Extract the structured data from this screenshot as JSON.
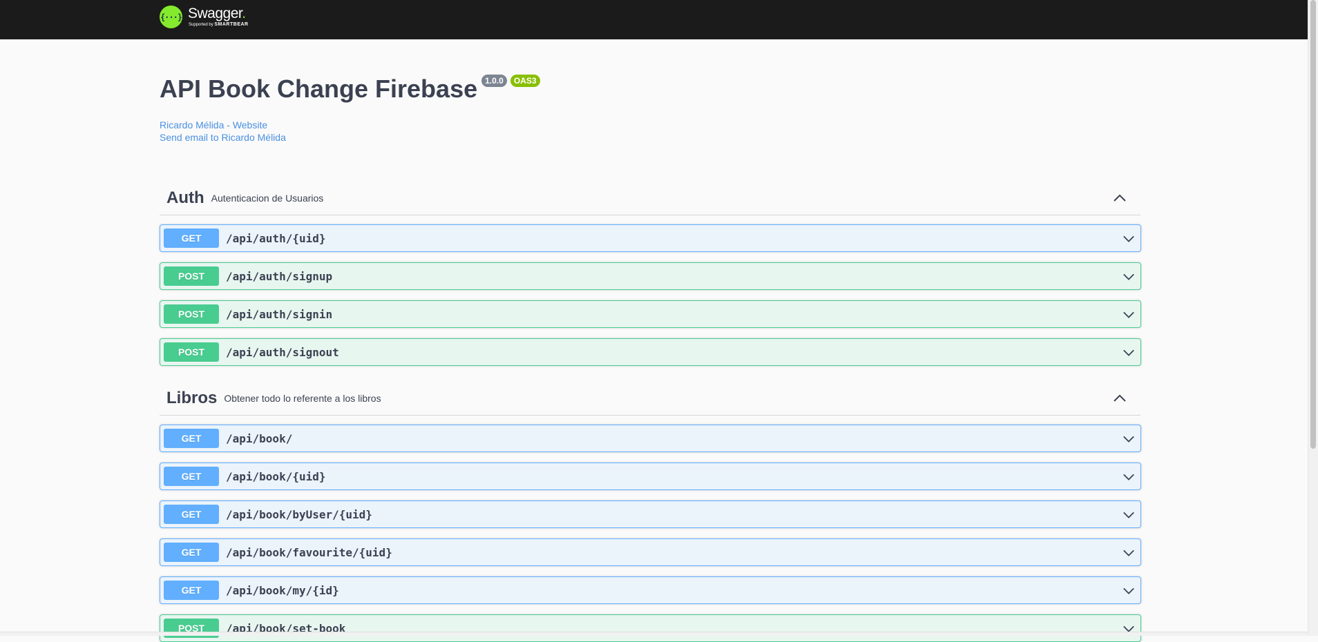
{
  "topbar": {
    "logo_mark": "{···}",
    "logo_name": "Swagger",
    "logo_sub_prefix": "Supported by",
    "logo_sub_brand": "SMARTBEAR"
  },
  "info": {
    "title": "API Book Change Firebase",
    "version": "1.0.0",
    "oas": "OAS3",
    "contact_website": "Ricardo Mélida - Website",
    "contact_email": "Send email to Ricardo Mélida"
  },
  "sections": [
    {
      "name": "Auth",
      "description": "Autenticacion de Usuarios",
      "operations": [
        {
          "method": "GET",
          "path": "/api/auth/{uid}"
        },
        {
          "method": "POST",
          "path": "/api/auth/signup"
        },
        {
          "method": "POST",
          "path": "/api/auth/signin"
        },
        {
          "method": "POST",
          "path": "/api/auth/signout"
        }
      ]
    },
    {
      "name": "Libros",
      "description": "Obtener todo lo referente a los libros",
      "operations": [
        {
          "method": "GET",
          "path": "/api/book/"
        },
        {
          "method": "GET",
          "path": "/api/book/{uid}"
        },
        {
          "method": "GET",
          "path": "/api/book/byUser/{uid}"
        },
        {
          "method": "GET",
          "path": "/api/book/favourite/{uid}"
        },
        {
          "method": "GET",
          "path": "/api/book/my/{id}"
        },
        {
          "method": "POST",
          "path": "/api/book/set-book"
        }
      ]
    }
  ],
  "colors": {
    "get": "#61affe",
    "post": "#49cc90",
    "link": "#4990e2",
    "brand": "#85ea2d"
  }
}
